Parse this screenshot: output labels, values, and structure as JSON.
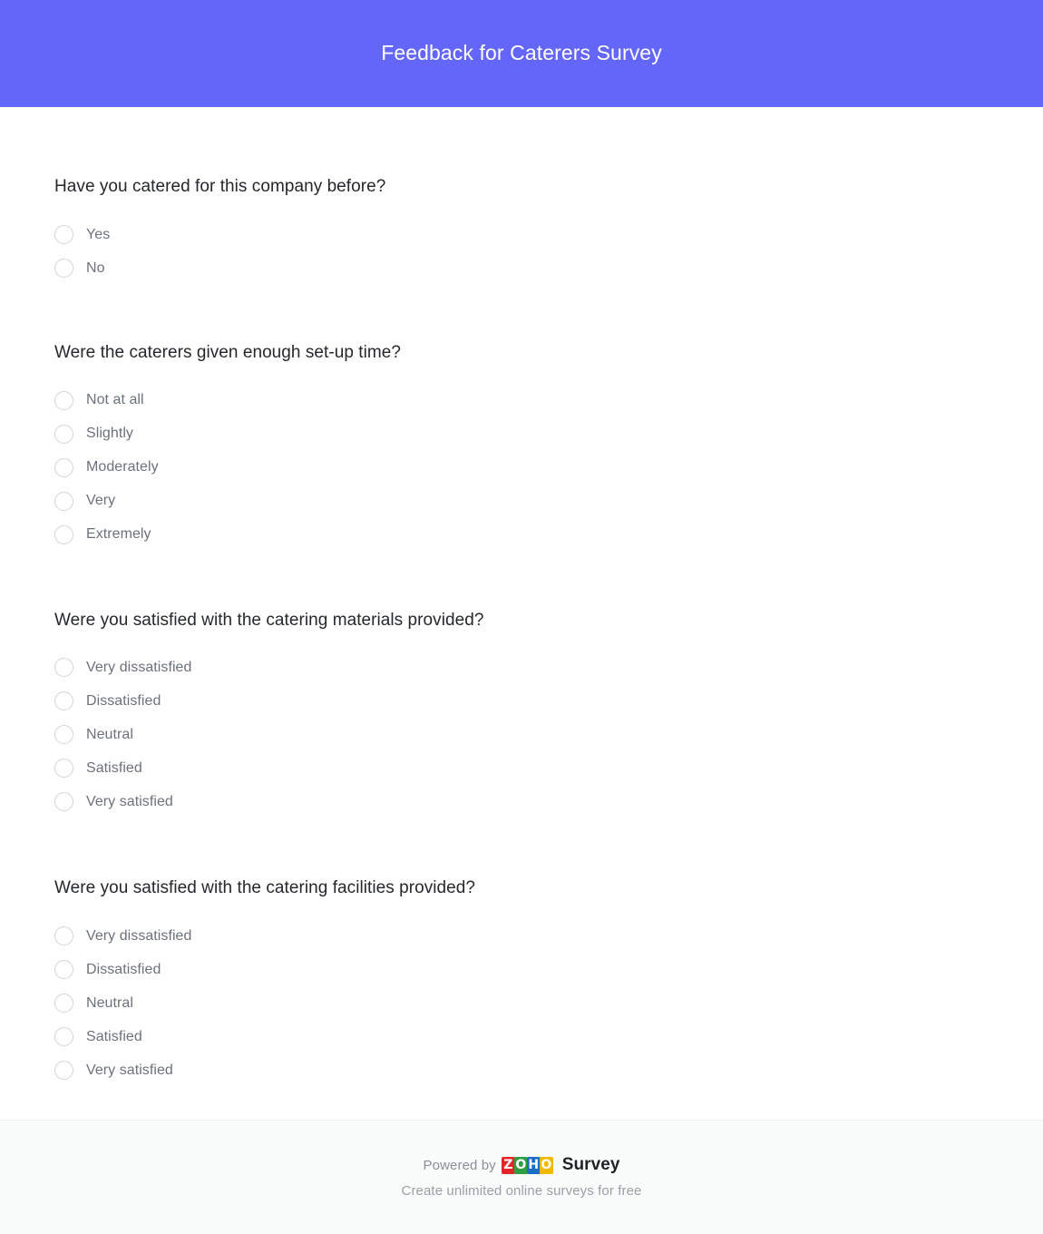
{
  "header": {
    "title": "Feedback for Caterers Survey",
    "background_color": "#6366f8",
    "title_color": "#ffffff"
  },
  "survey": {
    "questions": [
      {
        "title": "Have you catered for this company before?",
        "type": "radio",
        "options": [
          "Yes",
          "No"
        ]
      },
      {
        "title": "Were the caterers given enough set-up time?",
        "type": "radio",
        "options": [
          "Not at all",
          "Slightly",
          "Moderately",
          "Very",
          "Extremely"
        ]
      },
      {
        "title": "Were you satisfied with the catering materials provided?",
        "type": "radio",
        "options": [
          "Very dissatisfied",
          "Dissatisfied",
          "Neutral",
          "Satisfied",
          "Very satisfied"
        ]
      },
      {
        "title": "Were you satisfied with the catering facilities provided?",
        "type": "radio",
        "options": [
          "Very dissatisfied",
          "Dissatisfied",
          "Neutral",
          "Satisfied",
          "Very satisfied"
        ]
      }
    ]
  },
  "footer": {
    "powered_by": "Powered by",
    "brand_tiles": [
      {
        "letter": "Z",
        "color": "#e42527"
      },
      {
        "letter": "O",
        "color": "#2e9e42"
      },
      {
        "letter": "H",
        "color": "#1a6fc4"
      },
      {
        "letter": "O",
        "color": "#f5b800"
      }
    ],
    "brand_word": "Survey",
    "tagline": "Create unlimited online surveys for free",
    "background_color": "#fafbfb"
  }
}
